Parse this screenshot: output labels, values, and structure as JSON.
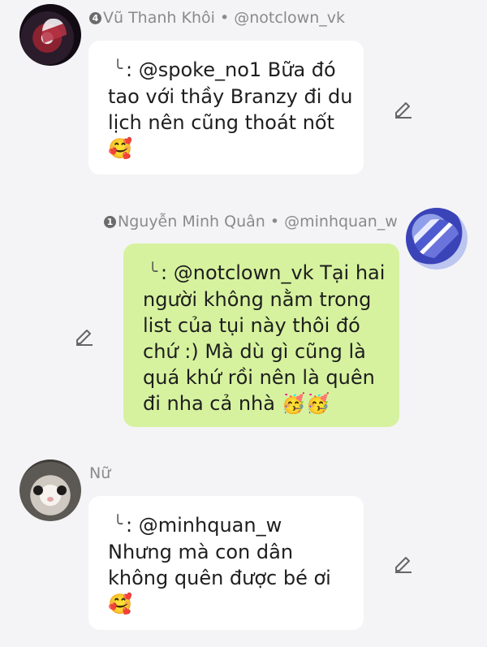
{
  "messages": [
    {
      "sender_badge": "4",
      "sender_name": "Vũ Thanh Khôi",
      "sender_separator": "•",
      "sender_handle": "@notclown_vk",
      "reply_arrow": "╰",
      "lines": [
        ": @spoke_no1 Bữa đó",
        "tao với thầy Branzy đi du",
        "lịch nên cũng thoát nốt",
        "🥰"
      ],
      "edit_icon": "pencil-icon"
    },
    {
      "sender_badge": "1",
      "sender_name": "Nguyễn Minh Quân",
      "sender_separator": "•",
      "sender_handle": "@minhquan_w",
      "reply_arrow": "╰",
      "lines": [
        ": @notclown_vk Tại hai",
        "người không nằm trong",
        "list của tụi này thôi đó",
        "chứ :) Mà dù gì cũng là",
        "quá khứ rồi nên là quên",
        "đi nha cả nhà 🥳🥳"
      ],
      "edit_icon": "pencil-icon"
    },
    {
      "sender_name": "Nữ",
      "reply_arrow": "╰",
      "lines": [
        ": @minhquan_w",
        "Nhưng mà con dân",
        "không quên được bé ơi",
        "🥰"
      ],
      "edit_icon": "pencil-icon"
    }
  ],
  "colors": {
    "background": "#f4f4f6",
    "incoming_bubble": "#ffffff",
    "outgoing_bubble": "#d6f29e",
    "sender_text": "#8a8a8a"
  }
}
